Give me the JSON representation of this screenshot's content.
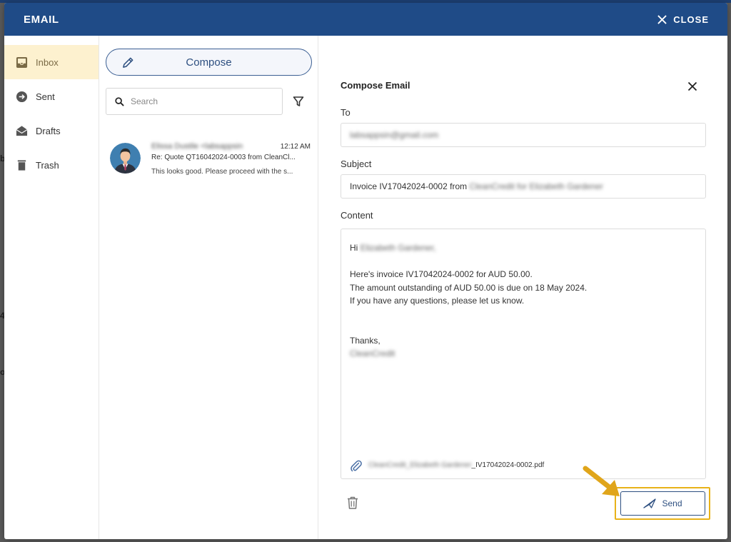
{
  "modal": {
    "title": "EMAIL",
    "close_label": "CLOSE"
  },
  "nav": {
    "items": [
      {
        "label": "Inbox",
        "icon": "inbox-icon",
        "active": true
      },
      {
        "label": "Sent",
        "icon": "sent-icon"
      },
      {
        "label": "Drafts",
        "icon": "drafts-icon"
      },
      {
        "label": "Trash",
        "icon": "trash-icon"
      }
    ]
  },
  "list": {
    "compose_label": "Compose",
    "search_placeholder": "Search",
    "messages": [
      {
        "sender": "Elissa Dustile <labsappsin",
        "time": "12:12 AM",
        "subject": "Re: Quote QT16042024-0003 from CleanCl...",
        "preview": "This looks good. Please proceed with the s..."
      }
    ]
  },
  "compose": {
    "title": "Compose Email",
    "to_label": "To",
    "to_value": "labsappsin@gmail.com",
    "subject_label": "Subject",
    "subject_prefix": "Invoice IV17042024-0002 from",
    "subject_redacted": "CleanCredit for Elizabeth Gardener",
    "content_label": "Content",
    "greeting": "Hi",
    "greeting_name": "Elizabeth Gardener,",
    "body_lines": [
      "Here's invoice IV17042024-0002 for AUD 50.00.",
      "The amount outstanding of AUD 50.00 is due on 18 May 2024.",
      "If you have any questions, please let us know."
    ],
    "signoff": "Thanks,",
    "signature": "CleanCredit",
    "attachment_redacted": "CleanCredit_Elizabeth Gardener",
    "attachment_suffix": "_IV17042024-0002.pdf",
    "send_label": "Send"
  },
  "colors": {
    "header": "#1f4b87",
    "accent": "#2d4f80",
    "active_nav": "#fdf1cf",
    "highlight": "#e8b219"
  }
}
